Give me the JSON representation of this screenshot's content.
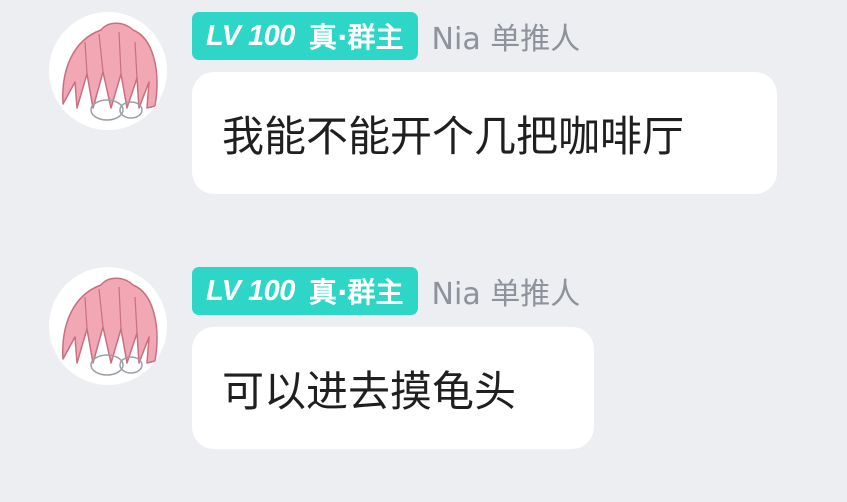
{
  "messages": [
    {
      "badge": {
        "level": "LV 100",
        "title": "真·群主"
      },
      "sender": "Nia 单推人",
      "text": "我能不能开个几把咖啡厅",
      "avatar_icon": "anime-avatar-pink-hair-icon"
    },
    {
      "badge": {
        "level": "LV 100",
        "title": "真·群主"
      },
      "sender": "Nia 单推人",
      "text": "可以进去摸龟头",
      "avatar_icon": "anime-avatar-pink-hair-icon"
    }
  ],
  "colors": {
    "background": "#eceef2",
    "badge": "#2ed6c8",
    "bubble": "#ffffff",
    "sender_name": "#8e939b",
    "hair": "#f2a7b4"
  }
}
